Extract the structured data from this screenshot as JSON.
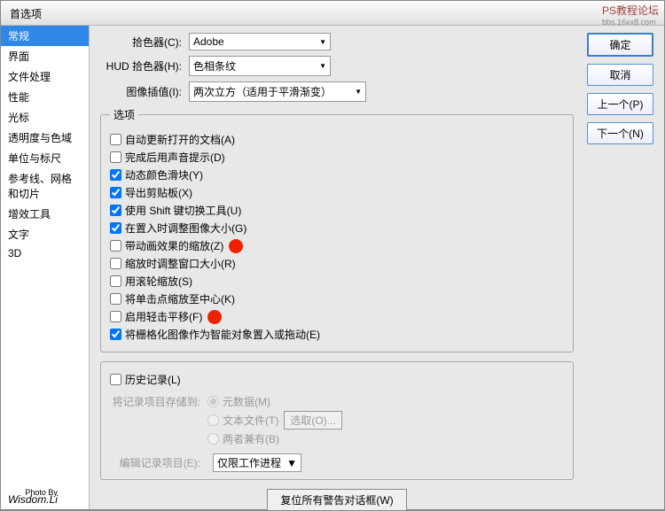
{
  "window": {
    "title": "首选项"
  },
  "watermark": {
    "line1": "PS教程论坛",
    "line2": "bbs.16xx8.com"
  },
  "sidebar": {
    "items": [
      {
        "label": "常规",
        "active": true
      },
      {
        "label": "界面"
      },
      {
        "label": "文件处理"
      },
      {
        "label": "性能"
      },
      {
        "label": "光标"
      },
      {
        "label": "透明度与色域"
      },
      {
        "label": "单位与标尺"
      },
      {
        "label": "参考线、网格和切片"
      },
      {
        "label": "增效工具"
      },
      {
        "label": "文字"
      },
      {
        "label": "3D"
      }
    ]
  },
  "pickers": {
    "color_picker_label": "拾色器(C):",
    "color_picker_value": "Adobe",
    "hud_label": "HUD 拾色器(H):",
    "hud_value": "色相条纹",
    "interp_label": "图像插值(I):",
    "interp_value": "两次立方（适用于平滑渐变）"
  },
  "options": {
    "legend": "选项",
    "items": [
      {
        "label": "自动更新打开的文档(A)",
        "checked": false
      },
      {
        "label": "完成后用声音提示(D)",
        "checked": false
      },
      {
        "label": "动态颜色滑块(Y)",
        "checked": true
      },
      {
        "label": "导出剪贴板(X)",
        "checked": true
      },
      {
        "label": "使用 Shift 键切换工具(U)",
        "checked": true
      },
      {
        "label": "在置入时调整图像大小(G)",
        "checked": true
      },
      {
        "label": "带动画效果的缩放(Z)",
        "checked": false,
        "dot": true
      },
      {
        "label": "缩放时调整窗口大小(R)",
        "checked": false
      },
      {
        "label": "用滚轮缩放(S)",
        "checked": false
      },
      {
        "label": "将单击点缩放至中心(K)",
        "checked": false
      },
      {
        "label": "启用轻击平移(F)",
        "checked": false,
        "dot": true
      },
      {
        "label": "将栅格化图像作为智能对象置入或拖动(E)",
        "checked": true
      }
    ]
  },
  "history": {
    "log_label": "历史记录(L)",
    "save_to_label": "将记录项目存储到:",
    "radios": [
      {
        "label": "元数据(M)",
        "checked": true
      },
      {
        "label": "文本文件(T)",
        "checked": false,
        "btn": "选取(O)..."
      },
      {
        "label": "两者兼有(B)",
        "checked": false
      }
    ],
    "edit_label": "编辑记录项目(E):",
    "edit_value": "仅限工作进程"
  },
  "reset": {
    "label": "复位所有警告对话框(W)"
  },
  "buttons": {
    "ok": "确定",
    "cancel": "取消",
    "prev": "上一个(P)",
    "next": "下一个(N)"
  },
  "signature": {
    "small": "Photo By",
    "name": "Wisdom.Li"
  }
}
